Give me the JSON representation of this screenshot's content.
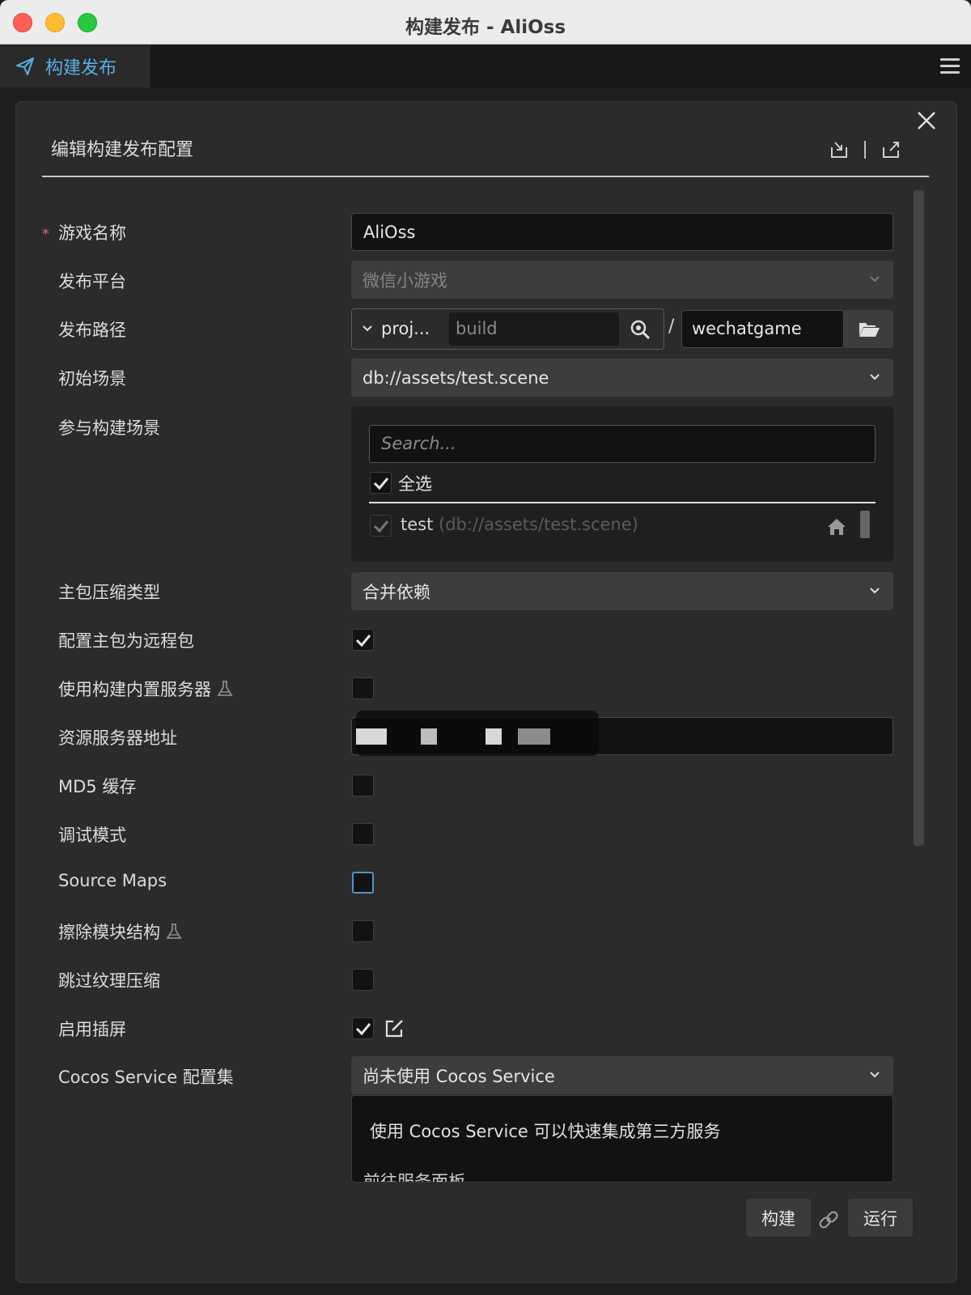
{
  "window": {
    "title": "构建发布 - AliOss"
  },
  "tab": {
    "label": "构建发布",
    "icon": "paper-plane-icon"
  },
  "panel": {
    "title": "编辑构建发布配置"
  },
  "fields": {
    "game_name": {
      "label": "游戏名称",
      "required_mark": "*",
      "value": "AliOss"
    },
    "platform": {
      "label": "发布平台",
      "value": "微信小游戏"
    },
    "path": {
      "label": "发布路径",
      "prefix": "proj...",
      "folder": "build",
      "separator": "/",
      "name": "wechatgame"
    },
    "start_scene": {
      "label": "初始场景",
      "value": "db://assets/test.scene"
    },
    "scenes": {
      "label": "参与构建场景",
      "search_placeholder": "Search...",
      "select_all": "全选",
      "select_all_checked": true,
      "items": [
        {
          "name": "test",
          "path": "(db://assets/test.scene)",
          "checked": true
        }
      ]
    },
    "compression": {
      "label": "主包压缩类型",
      "value": "合并依赖"
    },
    "remote_main": {
      "label": "配置主包为远程包",
      "checked": true
    },
    "builtin_server": {
      "label": "使用构建内置服务器",
      "checked": false
    },
    "server_address": {
      "label": "资源服务器地址",
      "value": ""
    },
    "md5": {
      "label": "MD5 缓存",
      "checked": false
    },
    "debug": {
      "label": "调试模式",
      "checked": false
    },
    "source_maps": {
      "label": "Source Maps",
      "checked": false
    },
    "erase_modules": {
      "label": "擦除模块结构",
      "checked": false
    },
    "skip_texture": {
      "label": "跳过纹理压缩",
      "checked": false
    },
    "splash": {
      "label": "启用插屏",
      "checked": true
    },
    "cocos_service": {
      "label": "Cocos Service 配置集",
      "value": "尚未使用 Cocos Service",
      "info": "使用 Cocos Service 可以快速集成第三方服务",
      "link": "前往服务面板"
    }
  },
  "buttons": {
    "build": "构建",
    "run": "运行"
  },
  "colors": {
    "accent": "#5ab0e6",
    "required": "#e3606a",
    "panel": "#2b2b2b"
  }
}
